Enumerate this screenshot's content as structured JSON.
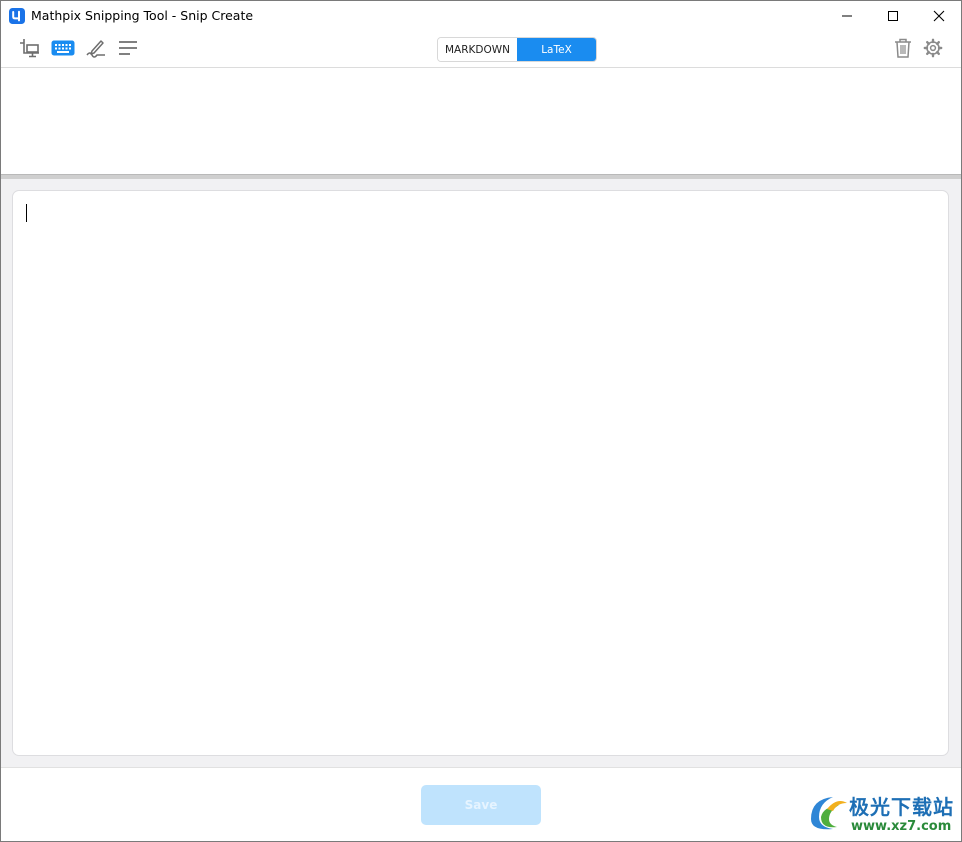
{
  "window": {
    "title": "Mathpix Snipping Tool - Snip Create"
  },
  "toolbar": {
    "tools": [
      "crop-screen-icon",
      "keyboard-icon",
      "pen-icon",
      "lines-icon"
    ],
    "mode_toggle": {
      "markdown_label": "MARKDOWN",
      "latex_label": "LaTeX",
      "selected": "LaTeX"
    },
    "actions": [
      "trash-icon",
      "gear-icon"
    ]
  },
  "editor": {
    "value": ""
  },
  "footer": {
    "save_label": "Save"
  },
  "watermark": {
    "brand_cn": "极光下载站",
    "url": "www.xz7.com"
  },
  "colors": {
    "accent": "#1a8cf0",
    "save_disabled": "#bfe3fd"
  }
}
